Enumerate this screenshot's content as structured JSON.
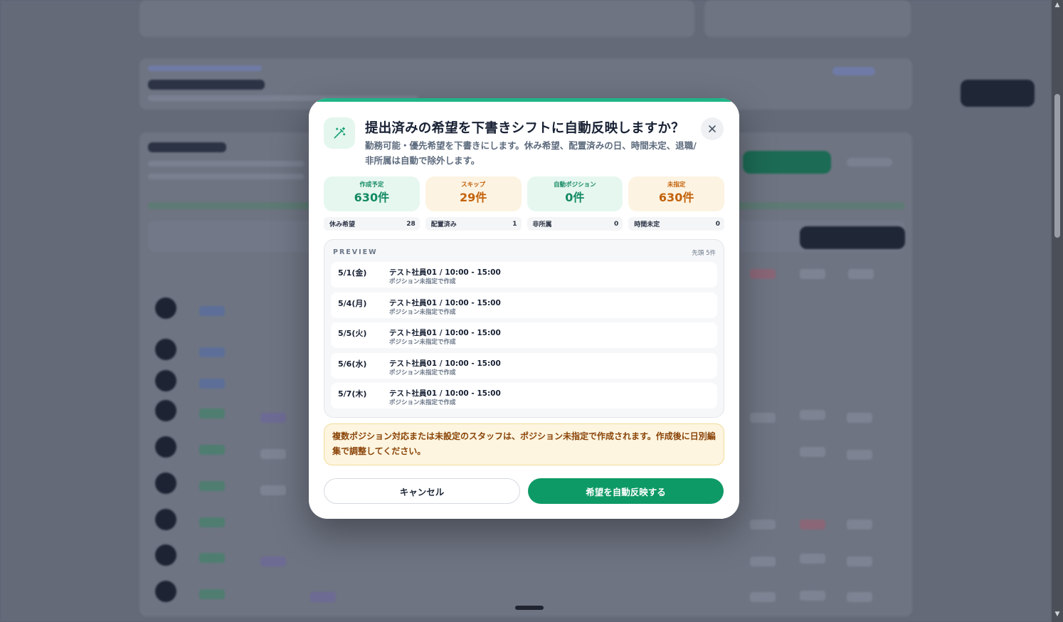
{
  "dialog": {
    "title": "提出済みの希望を下書きシフトに自動反映しますか？",
    "description": "勤務可能・優先希望を下書きにします。休み希望、配置済みの日、時間未定、退職/非所属は自動で除外します。",
    "close_icon": "close-icon",
    "header_icon": "magic-wand-icon"
  },
  "stats": [
    {
      "label": "作成予定",
      "value": "630件",
      "tone": "green"
    },
    {
      "label": "スキップ",
      "value": "29件",
      "tone": "amber"
    },
    {
      "label": "自動ポジション",
      "value": "0件",
      "tone": "green"
    },
    {
      "label": "未指定",
      "value": "630件",
      "tone": "amber"
    }
  ],
  "substats": [
    {
      "label": "休み希望",
      "value": "28"
    },
    {
      "label": "配置済み",
      "value": "1"
    },
    {
      "label": "非所属",
      "value": "0"
    },
    {
      "label": "時間未定",
      "value": "0"
    }
  ],
  "preview": {
    "heading": "PREVIEW",
    "count": "先頭 5件",
    "rows": [
      {
        "date": "5/1(金)",
        "main": "テスト社員01 / 10:00 - 15:00",
        "sub": "ポジション未指定で作成"
      },
      {
        "date": "5/4(月)",
        "main": "テスト社員01 / 10:00 - 15:00",
        "sub": "ポジション未指定で作成"
      },
      {
        "date": "5/5(火)",
        "main": "テスト社員01 / 10:00 - 15:00",
        "sub": "ポジション未指定で作成"
      },
      {
        "date": "5/6(水)",
        "main": "テスト社員01 / 10:00 - 15:00",
        "sub": "ポジション未指定で作成"
      },
      {
        "date": "5/7(木)",
        "main": "テスト社員01 / 10:00 - 15:00",
        "sub": "ポジション未指定で作成"
      }
    ]
  },
  "notice": "複数ポジション対応または未設定のスタッフは、ポジション未指定で作成されます。作成後に日別編集で調整してください。",
  "buttons": {
    "cancel": "キャンセル",
    "apply": "希望を自動反映する"
  },
  "colors": {
    "accent": "#0e9a66",
    "green_text": "#138a63",
    "amber_text": "#c2620a",
    "notice_text": "#8a4408"
  }
}
